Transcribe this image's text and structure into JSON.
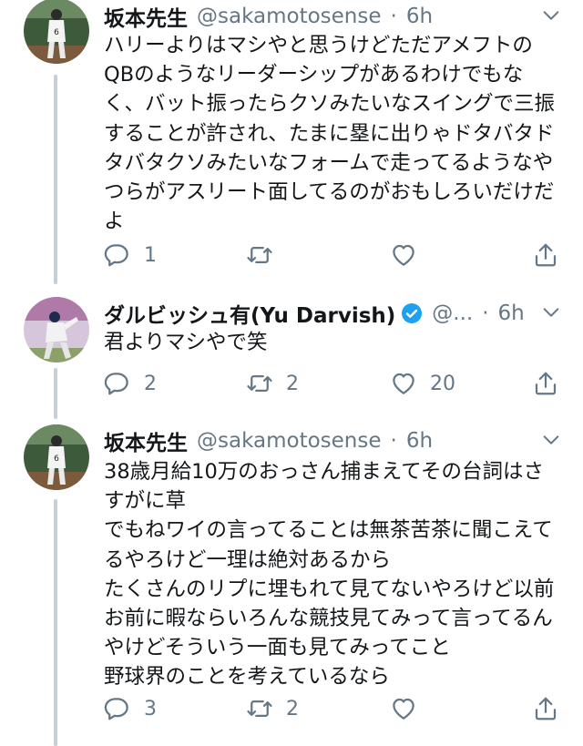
{
  "tweets": [
    {
      "name": "坂本先生",
      "handle": "@sakamotosense",
      "time": "6h",
      "verified": false,
      "lines": [
        "ハリーよりはマシやと思うけどただアメフトの",
        "QBのようなリーダーシップがあるわけでもな",
        "く、バット振ったらクソみたいなスイングで三振",
        "することが許され、たまに塁に出りゃドタバタド",
        "タバタクソみたいなフォームで走ってるようなや",
        "つらがアスリート面してるのがおもしろいだけだ",
        "よ"
      ],
      "replies": "1",
      "retweets": "",
      "likes": ""
    },
    {
      "name": "ダルビッシュ有(Yu Darvish)",
      "handle": "@...",
      "time": "6h",
      "verified": true,
      "lines": [
        "君よりマシやで笑"
      ],
      "replies": "2",
      "retweets": "2",
      "likes": "20"
    },
    {
      "name": "坂本先生",
      "handle": "@sakamotosense",
      "time": "6h",
      "verified": false,
      "lines": [
        "38歳月給10万のおっさん捕まえてその台詞はさ",
        "すがに草",
        "でもねワイの言ってることは無茶苦茶に聞こえて",
        "るやろけど一理は絶対あるから",
        "たくさんのリプに埋もれて見てないやろけど以前",
        "お前に暇ならいろんな競技見てみって言ってるん",
        "やけどそういう一面も見てみってこと",
        "野球界のことを考えているなら"
      ],
      "replies": "3",
      "retweets": "2",
      "likes": ""
    }
  ],
  "icons": {
    "reply": "reply-icon",
    "retweet": "retweet-icon",
    "like": "heart-icon",
    "share": "share-icon",
    "more": "chevron-down-icon",
    "verified": "verified-badge-icon"
  },
  "colors": {
    "text": "#14171a",
    "muted": "#657786",
    "verified": "#1da1f2",
    "thread_line": "#c4cfd6"
  }
}
